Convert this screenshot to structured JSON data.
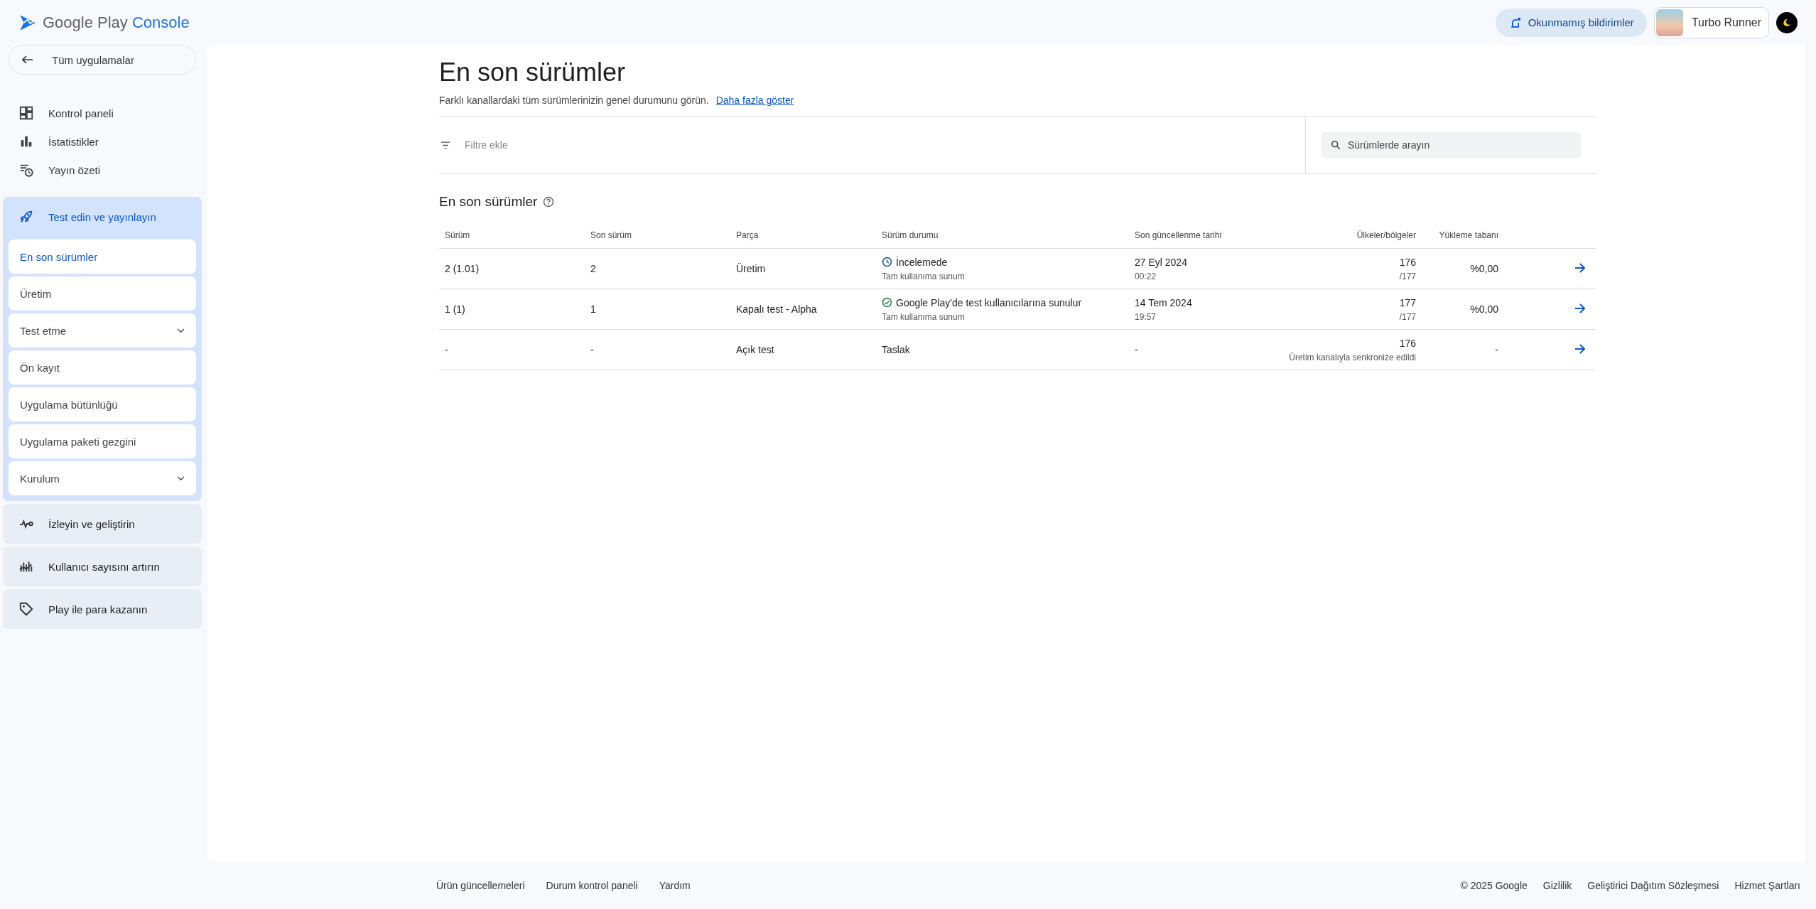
{
  "header": {
    "logo_text": "Google Play",
    "logo_accent": "Console",
    "notifications_button": "Okunmamış bildirimler",
    "app_name": "Turbo Runner"
  },
  "sidebar": {
    "back_link": "Tüm uygulamalar",
    "items": [
      {
        "label": "Kontrol paneli",
        "kind": "dashboard"
      },
      {
        "label": "İstatistikler",
        "kind": "stats"
      },
      {
        "label": "Yayın özeti",
        "kind": "overview"
      }
    ],
    "sections": [
      {
        "label": "Test edin ve yayınlayın",
        "kind": "rocket",
        "expanded": true,
        "children": [
          {
            "label": "En son sürümler",
            "selected": true,
            "expandable": false
          },
          {
            "label": "Üretim",
            "selected": false,
            "expandable": false
          },
          {
            "label": "Test etme",
            "selected": false,
            "expandable": true
          },
          {
            "label": "Ön kayıt",
            "selected": false,
            "expandable": false
          },
          {
            "label": "Uygulama bütünlüğü",
            "selected": false,
            "expandable": false
          },
          {
            "label": "Uygulama paketi gezgini",
            "selected": false,
            "expandable": false
          },
          {
            "label": "Kurulum",
            "selected": false,
            "expandable": true
          }
        ]
      },
      {
        "label": "İzleyin ve geliştirin",
        "kind": "vitals",
        "expanded": false
      },
      {
        "label": "Kullanıcı sayısını artırın",
        "kind": "grow",
        "expanded": false
      },
      {
        "label": "Play ile para kazanın",
        "kind": "tag",
        "expanded": false
      }
    ]
  },
  "page": {
    "title": "En son sürümler",
    "description": "Farklı kanallardaki tüm sürümlerinizin genel durumunu görün.",
    "more_link": "Daha fazla göster"
  },
  "filter": {
    "placeholder": "Filtre ekle"
  },
  "search": {
    "placeholder": "Sürümlerde arayın"
  },
  "table": {
    "title": "En son sürümler",
    "columns": [
      "Sürüm",
      "Son sürüm",
      "Parça",
      "Sürüm durumu",
      "Son güncellenme tarihi",
      "Ülkeler/bölgeler",
      "Yükleme tabanı"
    ],
    "rows": [
      {
        "release": "2 (1.01)",
        "version": "2",
        "track": "Üretim",
        "status": {
          "kind": "in_review",
          "label": "İncelemede",
          "detail": "Tam kullanıma sunum"
        },
        "updated": {
          "date": "27 Eyl 2024",
          "time": "00:22"
        },
        "countries": {
          "count": "176",
          "detail": "/177"
        },
        "install_base": "%0,00"
      },
      {
        "release": "1 (1)",
        "version": "1",
        "track": "Kapalı test - Alpha",
        "status": {
          "kind": "available",
          "label": "Google Play'de test kullanıcılarına sunulur",
          "detail": "Tam kullanıma sunum"
        },
        "updated": {
          "date": "14 Tem 2024",
          "time": "19:57"
        },
        "countries": {
          "count": "177",
          "detail": "/177"
        },
        "install_base": "%0,00"
      },
      {
        "release": "-",
        "version": "-",
        "track": "Açık test",
        "status": {
          "kind": "draft",
          "label": "Taslak"
        },
        "updated": {
          "date": "-"
        },
        "countries": {
          "count": "176",
          "detail": "Üretim kanalıyla senkronize edildi"
        },
        "install_base": "-"
      }
    ]
  },
  "footer": {
    "left_links": [
      "Ürün güncellemeleri",
      "Durum kontrol paneli",
      "Yardım"
    ],
    "copyright": "© 2025 Google",
    "right_links": [
      "Gizlilik",
      "Geliştirici Dağıtım Sözleşmesi",
      "Hizmet Şartları"
    ]
  }
}
